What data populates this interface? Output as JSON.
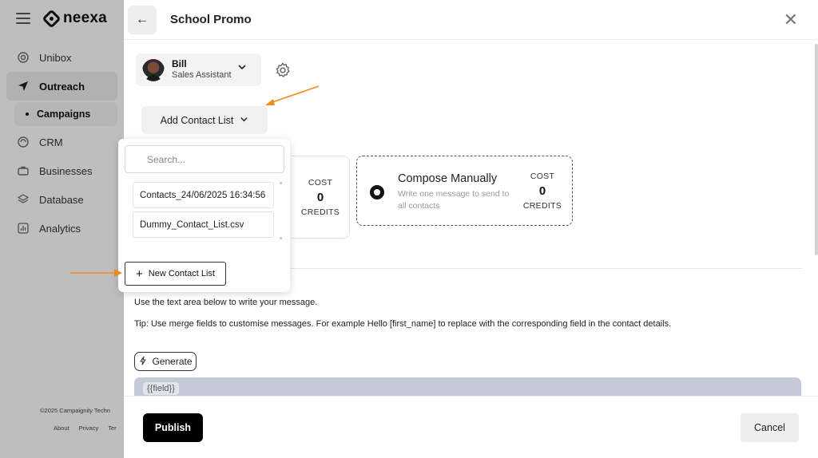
{
  "sidebar": {
    "brand": "neexa",
    "items": [
      {
        "label": "Unibox",
        "icon": "inbox-icon"
      },
      {
        "label": "Outreach",
        "icon": "send-icon",
        "active": true
      },
      {
        "label": "CRM",
        "icon": "crm-icon"
      },
      {
        "label": "Businesses",
        "icon": "briefcase-icon"
      },
      {
        "label": "Database",
        "icon": "layers-icon"
      },
      {
        "label": "Analytics",
        "icon": "chart-icon"
      }
    ],
    "sub_item": "Campaigns",
    "footer": "©2025 Campaignity Techn",
    "links": [
      "About",
      "Privacy",
      "Ter"
    ]
  },
  "panel": {
    "title": "School Promo",
    "agent": {
      "name": "Bill",
      "role": "Sales Assistant"
    },
    "add_contact_list": "Add Contact List",
    "dropdown": {
      "search_placeholder": "Search...",
      "items": [
        "Contacts_24/06/2025 16:34:56",
        "Dummy_Contact_List.csv"
      ],
      "new_list": "New Contact List"
    },
    "card_left": {
      "cost_label": "COST",
      "cost_value": "0",
      "cost_unit": "CREDITS"
    },
    "card_right": {
      "title": "Compose Manually",
      "desc": "Write one message to send to all contacts",
      "cost_label": "COST",
      "cost_value": "0",
      "cost_unit": "CREDITS"
    },
    "instruction": "Use the text area below to write your message.",
    "tip": "Tip: Use merge fields to customise messages. For example Hello [first_name] to replace with the corresponding field in the contact details.",
    "generate": "Generate",
    "field_chip": "{{field}}",
    "publish": "Publish",
    "cancel": "Cancel"
  },
  "colors": {
    "arrow": "#f08c1e",
    "primary": "#000000"
  }
}
